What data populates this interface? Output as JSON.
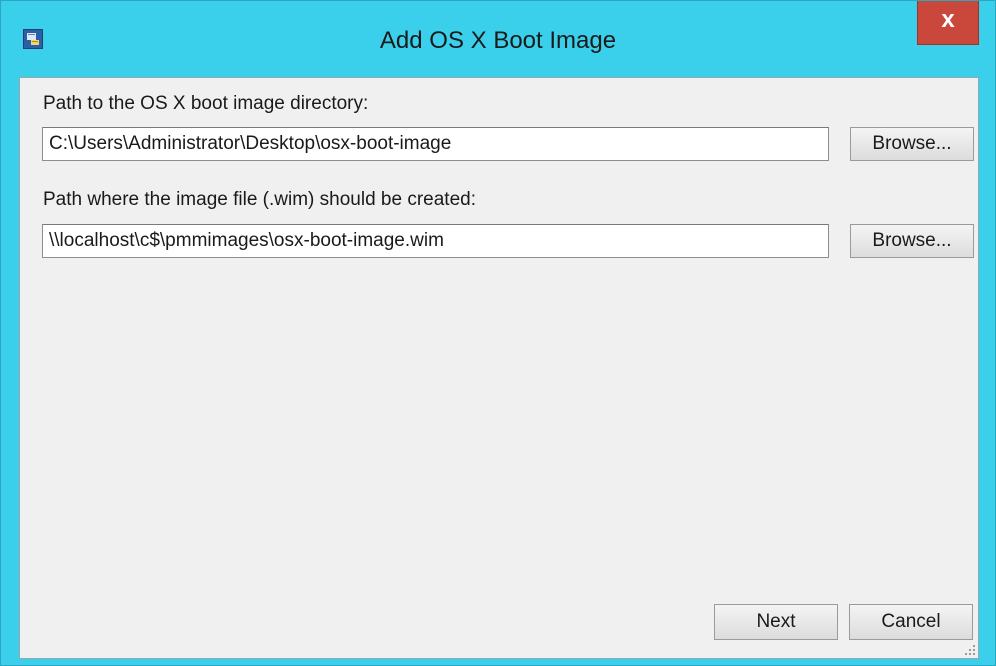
{
  "window": {
    "title": "Add OS X Boot Image",
    "close_label": "x"
  },
  "fields": [
    {
      "label": "Path to the OS X boot image directory:",
      "value": "C:\\Users\\Administrator\\Desktop\\osx-boot-image",
      "browse_label": "Browse..."
    },
    {
      "label": "Path where the image file (.wim) should be created:",
      "value": "\\\\localhost\\c$\\pmmimages\\osx-boot-image.wim",
      "browse_label": "Browse..."
    }
  ],
  "footer": {
    "next_label": "Next",
    "cancel_label": "Cancel"
  },
  "icons": {
    "app": "app-window-icon",
    "close": "close-icon",
    "resize": "resize-grip-icon"
  },
  "colors": {
    "frame": "#3ad0ec",
    "close": "#c9483b",
    "client_bg": "#f0f0f0"
  }
}
